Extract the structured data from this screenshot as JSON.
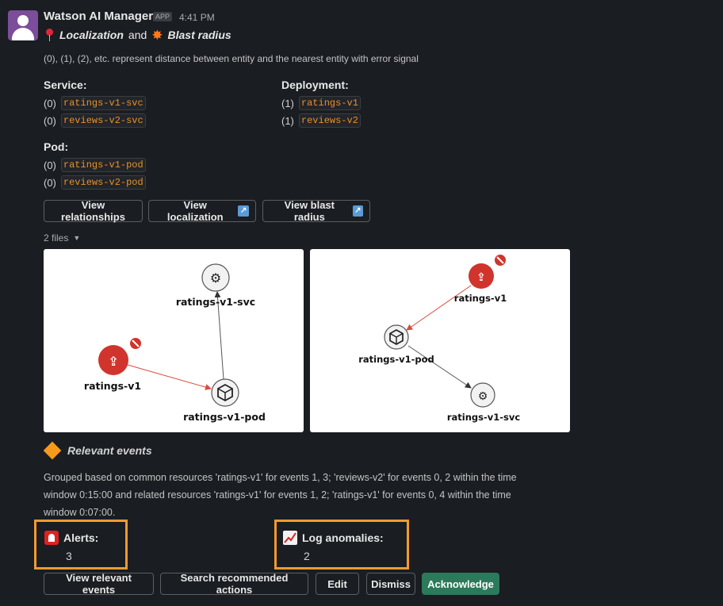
{
  "message": {
    "sender": "Watson AI Manager",
    "badge": "APP",
    "time": "4:41 PM",
    "subtitle_part1": "Localization",
    "subtitle_and": "and",
    "subtitle_part2": "Blast radius",
    "note": "(0), (1), (2), etc. represent distance between entity and the nearest entity with error signal"
  },
  "service": {
    "label": "Service:",
    "items": [
      {
        "distance": "(0)",
        "name": "ratings-v1-svc"
      },
      {
        "distance": "(0)",
        "name": "reviews-v2-svc"
      }
    ]
  },
  "deployment": {
    "label": "Deployment:",
    "items": [
      {
        "distance": "(1)",
        "name": "ratings-v1"
      },
      {
        "distance": "(1)",
        "name": "reviews-v2"
      }
    ]
  },
  "pod": {
    "label": "Pod:",
    "items": [
      {
        "distance": "(0)",
        "name": "ratings-v1-pod"
      },
      {
        "distance": "(0)",
        "name": "reviews-v2-pod"
      }
    ]
  },
  "links": {
    "relationships": "View relationships",
    "localization": "View localization",
    "blast_radius": "View blast radius"
  },
  "files": {
    "label": "2 files"
  },
  "graph1": {
    "svc": "ratings-v1-svc",
    "deploy": "ratings-v1",
    "pod": "ratings-v1-pod"
  },
  "graph2": {
    "deploy": "ratings-v1",
    "pod": "ratings-v1-pod",
    "svc": "ratings-v1-svc"
  },
  "events": {
    "title": "Relevant events",
    "description": "Grouped based on common resources 'ratings-v1' for events 1, 3; 'reviews-v2' for events 0, 2 within the time window 0:15:00 and related resources 'ratings-v1' for events 1, 2; 'ratings-v1' for events 0, 4 within the time window 0:07:00."
  },
  "alerts": {
    "label": "Alerts:",
    "value": "3"
  },
  "log_anomalies": {
    "label": "Log anomalies:",
    "value": "2"
  },
  "actions": {
    "view_events": "View relevant events",
    "search_actions": "Search recommended actions",
    "edit": "Edit",
    "dismiss": "Dismiss",
    "acknowledge": "Acknowledge"
  },
  "colors": {
    "background": "#1a1d21",
    "code_text": "#e8912d",
    "error_node": "#d0342c",
    "highlight": "#f29a2e",
    "acknowledge": "#2a7a5b"
  }
}
